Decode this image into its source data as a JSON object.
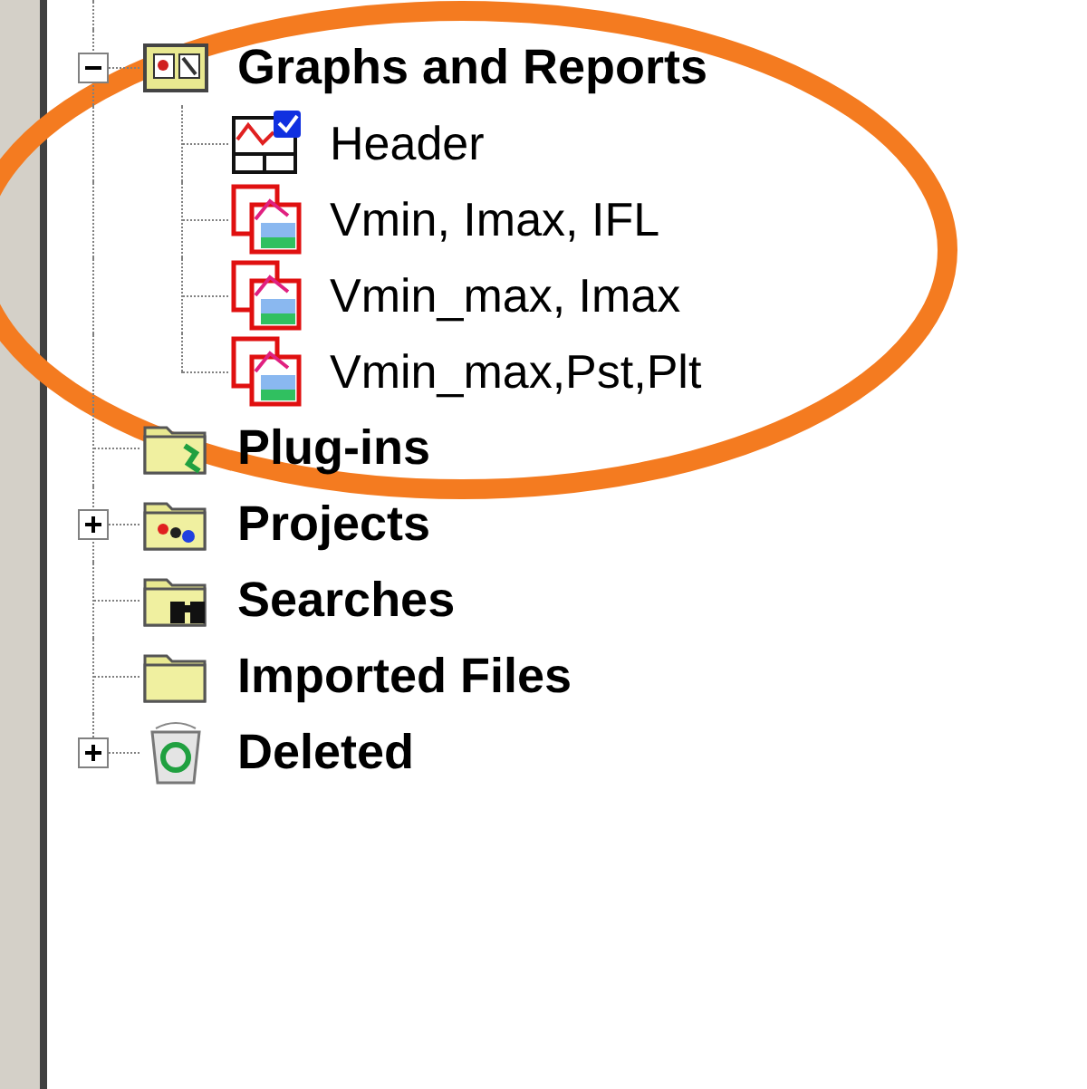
{
  "tree": [
    {
      "label": "Graphs and Reports",
      "kind": "reports",
      "expandable": true,
      "expanded": true,
      "children": [
        {
          "label": "Header",
          "kind": "header"
        },
        {
          "label": "Vmin, Imax, IFL",
          "kind": "graph"
        },
        {
          "label": "Vmin_max, Imax",
          "kind": "graph"
        },
        {
          "label": "Vmin_max,Pst,Plt",
          "kind": "graph"
        }
      ]
    },
    {
      "label": "Plug-ins",
      "kind": "plugins",
      "expandable": false
    },
    {
      "label": "Projects",
      "kind": "projects",
      "expandable": true,
      "expanded": false
    },
    {
      "label": "Searches",
      "kind": "searches",
      "expandable": false
    },
    {
      "label": "Imported Files",
      "kind": "folder",
      "expandable": false
    },
    {
      "label": "Deleted",
      "kind": "trash",
      "expandable": true,
      "expanded": false
    }
  ],
  "annotation": {
    "kind": "ellipse"
  }
}
